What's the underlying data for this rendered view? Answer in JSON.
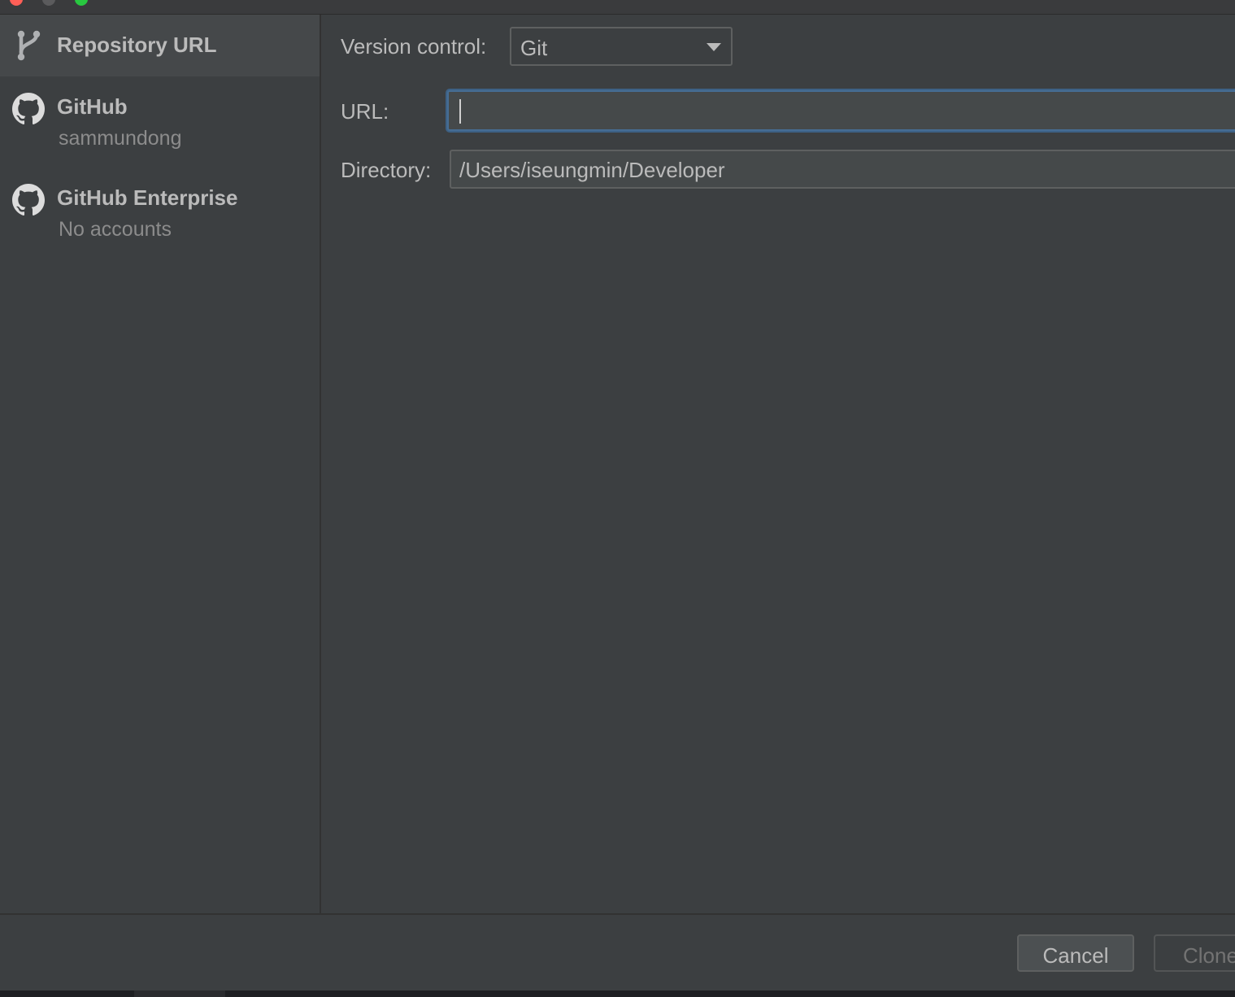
{
  "sidebar": {
    "items": [
      {
        "title": "Repository URL",
        "subtitle": "",
        "icon": "vcs-branch-icon",
        "selected": true
      },
      {
        "title": "GitHub",
        "subtitle": "sammundong",
        "icon": "github-icon",
        "selected": false
      },
      {
        "title": "GitHub Enterprise",
        "subtitle": "No accounts",
        "icon": "github-icon",
        "selected": false
      }
    ]
  },
  "form": {
    "version_control_label": "Version control:",
    "version_control_value": "Git",
    "url_label": "URL:",
    "url_value": "",
    "directory_label": "Directory:",
    "directory_value": "/Users/iseungmin/Developer"
  },
  "footer": {
    "cancel_label": "Cancel",
    "clone_label": "Clone"
  },
  "colors": {
    "background": "#3c3f41",
    "selected_item": "#45484a",
    "focus_border": "#466d94",
    "text": "#bbbbbb",
    "muted_text": "#8c8c8c"
  }
}
